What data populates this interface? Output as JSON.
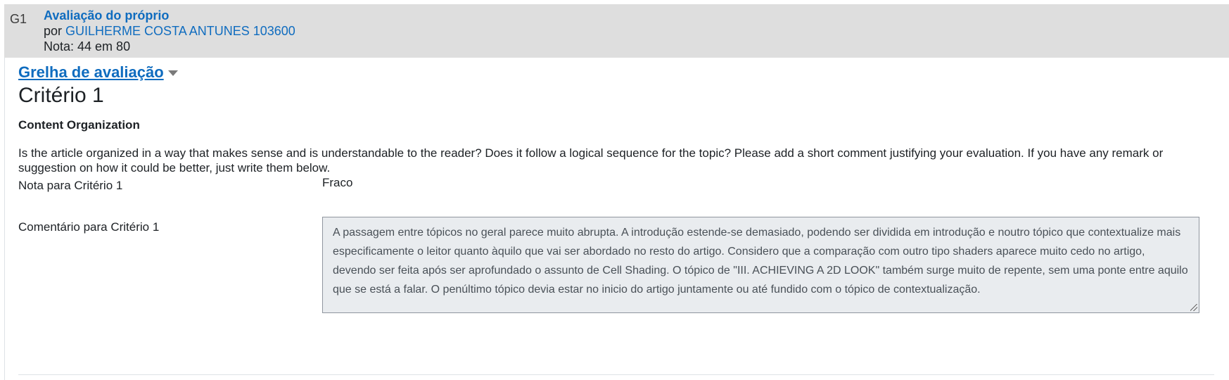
{
  "submission": {
    "avatar_initials": "G1",
    "title": "Avaliação do próprio",
    "by_prefix": "por",
    "author": "GUILHERME COSTA ANTUNES 103600",
    "grade": "Nota: 44 em 80"
  },
  "rubric": {
    "link_label": "Grelha de avaliação",
    "criterion_title": "Critério 1",
    "criterion_name": "Content Organization",
    "criterion_description": "Is the article organized in a way that makes sense and is understandable to the reader? Does it follow a logical sequence for the topic? Please add a short comment justifying your evaluation. If you have any remark or suggestion on how it could be better, just write them below.",
    "grade_label": "Nota para Critério 1",
    "grade_value": "Fraco",
    "comment_label": "Comentário para Critério 1",
    "comment_value": "A passagem entre tópicos no geral parece muito abrupta. A introdução estende-se demasiado, podendo ser dividida em introdução e noutro tópico que contextualize mais especificamente o leitor quanto àquilo que vai ser abordado no resto do artigo. Considero que a comparação com outro tipo shaders aparece muito cedo no artigo, devendo ser feita após ser aprofundado o assunto de Cell Shading. O tópico de \"III. ACHIEVING A 2D LOOK\" também surge muito de repente, sem uma ponte entre aquilo que se está a falar. O penúltimo tópico devia estar no inicio do artigo juntamente ou até fundido com o tópico de contextualização."
  }
}
